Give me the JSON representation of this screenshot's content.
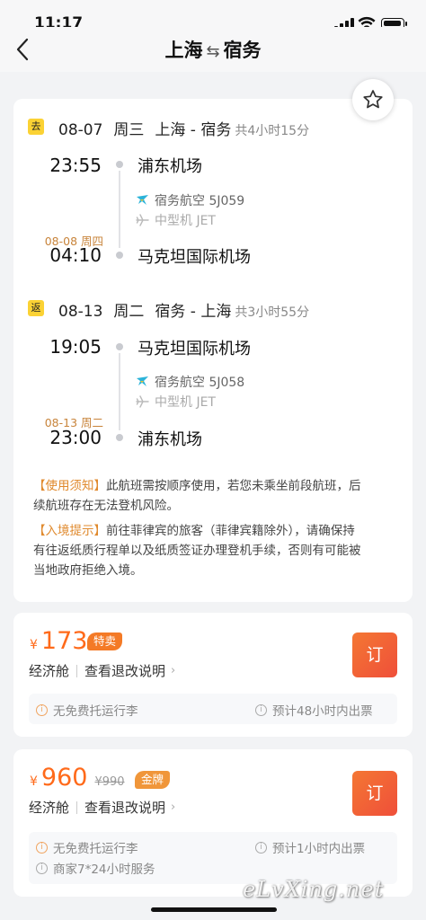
{
  "status_bar": {
    "time": "11:17"
  },
  "nav": {
    "origin": "上海",
    "swap": "⇆",
    "destination": "宿务",
    "back_icon": "chevron-left-icon"
  },
  "outbound": {
    "tag": "去",
    "date": "08-07",
    "weekday": "周三",
    "route": "上海 - 宿务",
    "duration": "共4小时15分",
    "dep_time": "23:55",
    "dep_airport": "浦东机场",
    "airline": "宿务航空 5J059",
    "aircraft": "中型机 JET",
    "arr_date": "08-08 周四",
    "arr_time": "04:10",
    "arr_airport": "马克坦国际机场"
  },
  "return": {
    "tag": "返",
    "date": "08-13",
    "weekday": "周二",
    "route": "宿务 - 上海",
    "duration": "共3小时55分",
    "dep_time": "19:05",
    "dep_airport": "马克坦国际机场",
    "airline": "宿务航空 5J058",
    "aircraft": "中型机 JET",
    "arr_date": "08-13 周二",
    "arr_time": "23:00",
    "arr_airport": "浦东机场"
  },
  "notices": {
    "usage_tag": "【使用须知】",
    "usage_line1": "此航班需按顺序使用，若您未乘坐前段航班，后",
    "usage_line2": "续航班存在无法登机风险。",
    "entry_tag": "【入境提示】",
    "entry_line1": "前往菲律宾的旅客（菲律宾籍除外），请确保持",
    "entry_line2": "有往返纸质行程单以及纸质签证办理登机手续，否则有可能被",
    "entry_line3": "当地政府拒绝入境。"
  },
  "offers": [
    {
      "currency": "¥",
      "price": "173",
      "badge": "特卖",
      "cabin": "经济舱",
      "rules": "查看退改说明",
      "book": "订",
      "tip_baggage": "无免费托运行李",
      "tip_ticket": "预计48小时内出票"
    },
    {
      "currency": "¥",
      "price": "960",
      "old_price": "¥990",
      "badge": "金牌",
      "cabin": "经济舱",
      "rules": "查看退改说明",
      "book": "订",
      "tip_baggage": "无免费托运行李",
      "tip_ticket": "预计1小时内出票",
      "tip_service": "商家7*24小时服务"
    }
  ],
  "watermark": "eLvXing.net",
  "colors": {
    "accent": "#ff6a1a",
    "tag_yellow": "#fbd234",
    "notice_tag": "#e08a2e",
    "book_gradient_start": "#f47733",
    "book_gradient_end": "#ef4f3a"
  }
}
